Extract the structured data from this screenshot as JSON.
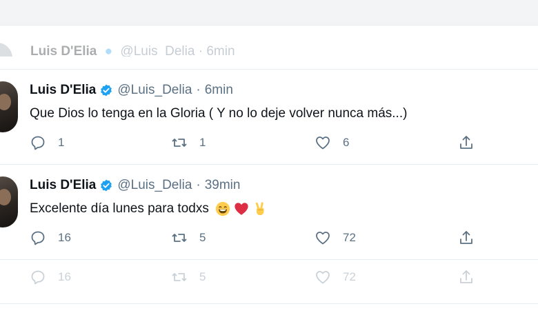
{
  "ghost_tweet": {
    "name": "Luis D'Elia",
    "handle": "@Luis_Delia",
    "time": "6min"
  },
  "tweets": [
    {
      "name": "Luis D'Elia",
      "handle": "@Luis_Delia",
      "separator": "·",
      "time": "6min",
      "text": "Que Dios lo tenga en la Gloria ( Y no lo deje volver nunca más...)",
      "replies": "1",
      "retweets": "1",
      "likes": "6"
    },
    {
      "name": "Luis D'Elia",
      "handle": "@Luis_Delia",
      "separator": "·",
      "time": "39min",
      "text": "Excelente día lunes para todxs",
      "emojis": [
        "grinning-face-emoji",
        "red-heart-emoji",
        "victory-hand-emoji"
      ],
      "replies": "16",
      "retweets": "5",
      "likes": "72"
    }
  ],
  "ghost_actions": {
    "replies": "16",
    "retweets": "5",
    "likes": "72"
  },
  "icons": {
    "verified": "verified-badge-icon",
    "reply": "reply-icon",
    "retweet": "retweet-icon",
    "like": "like-icon",
    "share": "share-icon"
  },
  "colors": {
    "verified": "#1da1f2",
    "text": "#0f1419",
    "secondary": "#5b7083",
    "divider": "#e6ecf0"
  }
}
